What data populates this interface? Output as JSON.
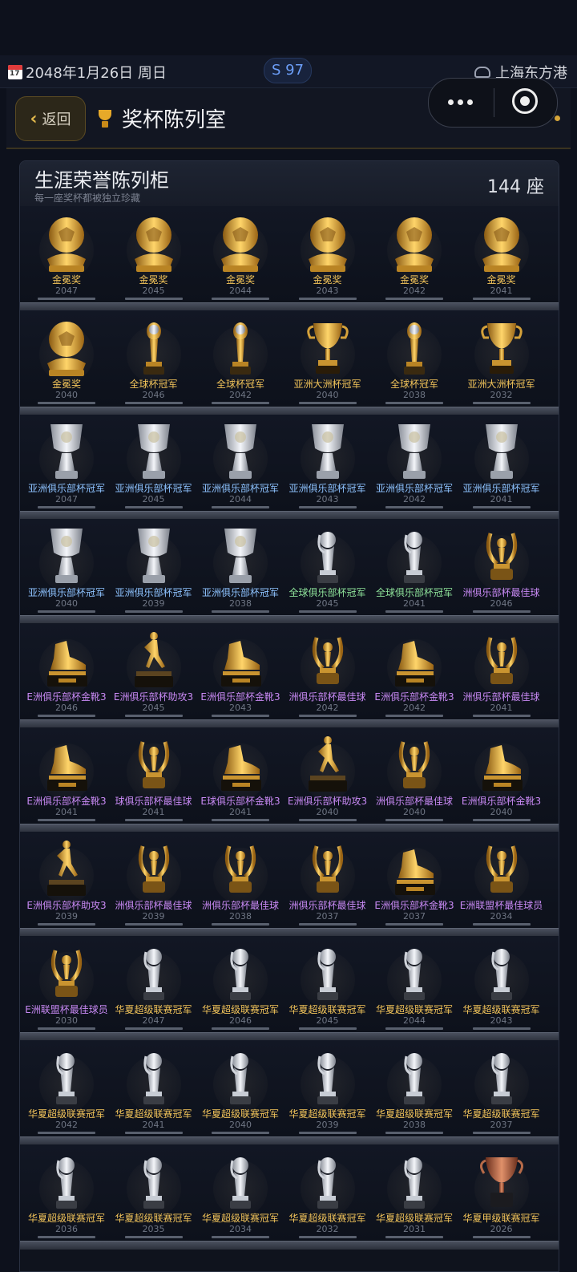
{
  "status_bar": {
    "date": "2048年1月26日 周日",
    "calendar_icon_text": "17",
    "season": "S 97",
    "club": "上海东方港"
  },
  "header": {
    "back_label": "返回",
    "title": "奖杯陈列室"
  },
  "cabinet": {
    "title": "生涯荣誉陈列柜",
    "subtitle": "每一座奖杯都被独立珍藏",
    "count": "144 座"
  },
  "colors": {
    "gold": "#f2c45a",
    "blue": "#8ec3ff",
    "green": "#8fe39a",
    "purple": "#c98af5"
  },
  "trophies": [
    {
      "name": "金冕奖",
      "year": "2047",
      "kind": "ball",
      "color": "gold"
    },
    {
      "name": "金冕奖",
      "year": "2045",
      "kind": "ball",
      "color": "gold"
    },
    {
      "name": "金冕奖",
      "year": "2044",
      "kind": "ball",
      "color": "gold"
    },
    {
      "name": "金冕奖",
      "year": "2043",
      "kind": "ball",
      "color": "gold"
    },
    {
      "name": "金冕奖",
      "year": "2042",
      "kind": "ball",
      "color": "gold"
    },
    {
      "name": "金冕奖",
      "year": "2041",
      "kind": "ball",
      "color": "gold"
    },
    {
      "name": "金冕奖",
      "year": "2040",
      "kind": "ball",
      "color": "gold"
    },
    {
      "name": "全球杯冠军",
      "year": "2046",
      "kind": "slim-gold",
      "color": "gold"
    },
    {
      "name": "全球杯冠军",
      "year": "2042",
      "kind": "slim-gold",
      "color": "gold"
    },
    {
      "name": "亚洲大洲杯冠军",
      "year": "2040",
      "kind": "cup-gold",
      "color": "gold"
    },
    {
      "name": "全球杯冠军",
      "year": "2038",
      "kind": "slim-gold",
      "color": "gold"
    },
    {
      "name": "亚洲大洲杯冠军",
      "year": "2032",
      "kind": "cup-gold",
      "color": "gold"
    },
    {
      "name": "亚洲俱乐部杯冠军",
      "year": "2047",
      "kind": "silver-cup",
      "color": "blue"
    },
    {
      "name": "亚洲俱乐部杯冠军",
      "year": "2045",
      "kind": "silver-cup",
      "color": "blue"
    },
    {
      "name": "亚洲俱乐部杯冠军",
      "year": "2044",
      "kind": "silver-cup",
      "color": "blue"
    },
    {
      "name": "亚洲俱乐部杯冠军",
      "year": "2043",
      "kind": "silver-cup",
      "color": "blue"
    },
    {
      "name": "亚洲俱乐部杯冠军",
      "year": "2042",
      "kind": "silver-cup",
      "color": "blue"
    },
    {
      "name": "亚洲俱乐部杯冠军",
      "year": "2041",
      "kind": "silver-cup",
      "color": "blue"
    },
    {
      "name": "亚洲俱乐部杯冠军",
      "year": "2040",
      "kind": "silver-cup",
      "color": "blue"
    },
    {
      "name": "亚洲俱乐部杯冠军",
      "year": "2039",
      "kind": "silver-cup",
      "color": "blue"
    },
    {
      "name": "亚洲俱乐部杯冠军",
      "year": "2038",
      "kind": "silver-cup",
      "color": "blue"
    },
    {
      "name": "全球俱乐部杯冠军",
      "year": "2045",
      "kind": "silver-slim",
      "color": "green"
    },
    {
      "name": "全球俱乐部杯冠军",
      "year": "2041",
      "kind": "silver-slim",
      "color": "green"
    },
    {
      "name": "洲俱乐部杯最佳球",
      "year": "2046",
      "kind": "laurel",
      "color": "purple"
    },
    {
      "name": "E洲俱乐部杯金靴3",
      "year": "2046",
      "kind": "boot",
      "color": "purple"
    },
    {
      "name": "E洲俱乐部杯助攻3",
      "year": "2045",
      "kind": "player",
      "color": "purple"
    },
    {
      "name": "E洲俱乐部杯金靴3",
      "year": "2043",
      "kind": "boot",
      "color": "purple"
    },
    {
      "name": "洲俱乐部杯最佳球",
      "year": "2042",
      "kind": "laurel",
      "color": "purple"
    },
    {
      "name": "E洲俱乐部杯金靴3",
      "year": "2042",
      "kind": "boot",
      "color": "purple"
    },
    {
      "name": "洲俱乐部杯最佳球",
      "year": "2041",
      "kind": "laurel",
      "color": "purple"
    },
    {
      "name": "E洲俱乐部杯金靴3",
      "year": "2041",
      "kind": "boot",
      "color": "purple"
    },
    {
      "name": "球俱乐部杯最佳球",
      "year": "2041",
      "kind": "laurel",
      "color": "purple"
    },
    {
      "name": "E球俱乐部杯金靴3",
      "year": "2041",
      "kind": "boot",
      "color": "purple"
    },
    {
      "name": "E洲俱乐部杯助攻3",
      "year": "2040",
      "kind": "player",
      "color": "purple"
    },
    {
      "name": "洲俱乐部杯最佳球",
      "year": "2040",
      "kind": "laurel",
      "color": "purple"
    },
    {
      "name": "E洲俱乐部杯金靴3",
      "year": "2040",
      "kind": "boot",
      "color": "purple"
    },
    {
      "name": "E洲俱乐部杯助攻3",
      "year": "2039",
      "kind": "player",
      "color": "purple"
    },
    {
      "name": "洲俱乐部杯最佳球",
      "year": "2039",
      "kind": "laurel",
      "color": "purple"
    },
    {
      "name": "洲俱乐部杯最佳球",
      "year": "2038",
      "kind": "laurel",
      "color": "purple"
    },
    {
      "name": "洲俱乐部杯最佳球",
      "year": "2037",
      "kind": "laurel",
      "color": "purple"
    },
    {
      "name": "E洲俱乐部杯金靴3",
      "year": "2037",
      "kind": "boot",
      "color": "purple"
    },
    {
      "name": "E洲联盟杯最佳球员",
      "year": "2034",
      "kind": "laurel",
      "color": "purple"
    },
    {
      "name": "E洲联盟杯最佳球员",
      "year": "2030",
      "kind": "laurel",
      "color": "purple"
    },
    {
      "name": "华夏超级联赛冠军",
      "year": "2047",
      "kind": "silver-slim",
      "color": "gold"
    },
    {
      "name": "华夏超级联赛冠军",
      "year": "2046",
      "kind": "silver-slim",
      "color": "gold"
    },
    {
      "name": "华夏超级联赛冠军",
      "year": "2045",
      "kind": "silver-slim",
      "color": "gold"
    },
    {
      "name": "华夏超级联赛冠军",
      "year": "2044",
      "kind": "silver-slim",
      "color": "gold"
    },
    {
      "name": "华夏超级联赛冠军",
      "year": "2043",
      "kind": "silver-slim",
      "color": "gold"
    },
    {
      "name": "华夏超级联赛冠军",
      "year": "2042",
      "kind": "silver-slim",
      "color": "gold"
    },
    {
      "name": "华夏超级联赛冠军",
      "year": "2041",
      "kind": "silver-slim",
      "color": "gold"
    },
    {
      "name": "华夏超级联赛冠军",
      "year": "2040",
      "kind": "silver-slim",
      "color": "gold"
    },
    {
      "name": "华夏超级联赛冠军",
      "year": "2039",
      "kind": "silver-slim",
      "color": "gold"
    },
    {
      "name": "华夏超级联赛冠军",
      "year": "2038",
      "kind": "silver-slim",
      "color": "gold"
    },
    {
      "name": "华夏超级联赛冠军",
      "year": "2037",
      "kind": "silver-slim",
      "color": "gold"
    },
    {
      "name": "华夏超级联赛冠军",
      "year": "2036",
      "kind": "silver-slim",
      "color": "gold"
    },
    {
      "name": "华夏超级联赛冠军",
      "year": "2035",
      "kind": "silver-slim",
      "color": "gold"
    },
    {
      "name": "华夏超级联赛冠军",
      "year": "2034",
      "kind": "silver-slim",
      "color": "gold"
    },
    {
      "name": "华夏超级联赛冠军",
      "year": "2032",
      "kind": "silver-slim",
      "color": "gold"
    },
    {
      "name": "华夏超级联赛冠军",
      "year": "2031",
      "kind": "silver-slim",
      "color": "gold"
    },
    {
      "name": "华夏甲级联赛冠军",
      "year": "2026",
      "kind": "bronze-cup",
      "color": "gold"
    }
  ]
}
